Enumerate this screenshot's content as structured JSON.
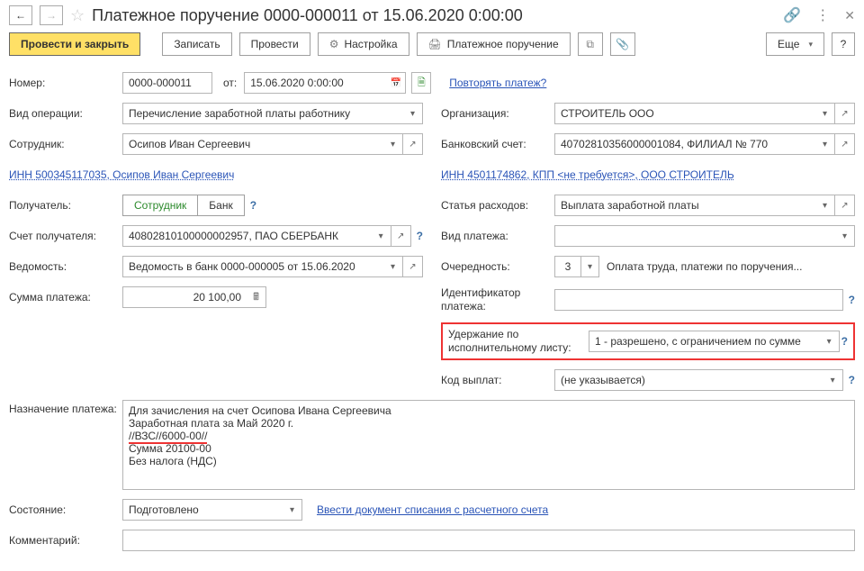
{
  "header": {
    "title": "Платежное поручение 0000-000011 от 15.06.2020 0:00:00"
  },
  "toolbar": {
    "post_and_close": "Провести и закрыть",
    "write": "Записать",
    "post": "Провести",
    "settings": "Настройка",
    "payment_order": "Платежное поручение",
    "more": "Еще",
    "help": "?"
  },
  "labels": {
    "number": "Номер:",
    "from": "от:",
    "repeat_link": "Повторять платеж?",
    "operation_type": "Вид операции:",
    "organization": "Организация:",
    "employee": "Сотрудник:",
    "bank_account": "Банковский счет:",
    "inn_employee_link": "ИНН 500345117035, Осипов Иван Сергеевич",
    "inn_kpp_link": "ИНН 4501174862, КПП <не требуется>, ООО СТРОИТЕЛЬ",
    "payee": "Получатель:",
    "seg_employee": "Сотрудник",
    "seg_bank": "Банк",
    "expense_item": "Статья расходов:",
    "payee_account": "Счет получателя:",
    "payment_type": "Вид платежа:",
    "vedomost": "Ведомость:",
    "priority": "Очередность:",
    "priority_text": "Оплата труда, платежи по поручения...",
    "payment_amount": "Сумма платежа:",
    "payment_id": "Идентификатор платежа:",
    "enforcement": "Удержание по исполнительному листу:",
    "payout_code": "Код выплат:",
    "purpose": "Назначение платежа:",
    "status": "Состояние:",
    "enter_doc_link": "Ввести документ списания с расчетного счета",
    "comment": "Комментарий:"
  },
  "values": {
    "number": "0000-000011",
    "date": "15.06.2020  0:00:00",
    "operation_type": "Перечисление заработной платы работнику",
    "organization": "СТРОИТЕЛЬ ООО",
    "employee": "Осипов Иван Сергеевич",
    "bank_account": "40702810356000001084, ФИЛИАЛ № 770",
    "expense_item": "Выплата заработной платы",
    "payee_account": "40802810100000002957, ПАО СБЕРБАНК",
    "payment_type": "",
    "vedomost": "Ведомость в банк 0000-000005 от 15.06.2020",
    "priority": "3",
    "amount": "20 100,00",
    "payment_id": "",
    "enforcement": "1 - разрешено, с ограничением по сумме",
    "payout_code": "(не указывается)",
    "purpose_line1": "Для зачисления на счет Осипова Ивана Сергеевича",
    "purpose_line2": "Заработная плата за Май 2020 г.",
    "purpose_line3": "//ВЗС//6000-00//",
    "purpose_line4": "Сумма 20100-00",
    "purpose_line5": "Без налога (НДС)",
    "status": "Подготовлено",
    "comment": ""
  }
}
